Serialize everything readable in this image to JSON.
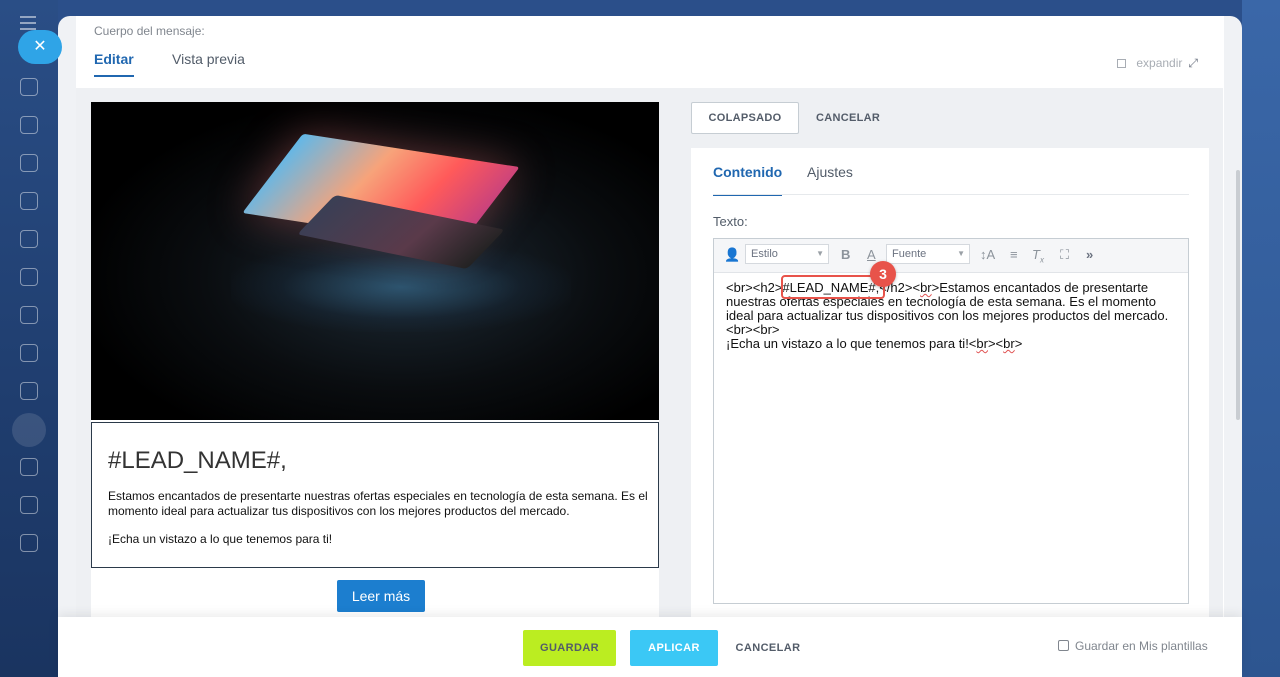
{
  "header": {
    "body_label": "Cuerpo del mensaje:",
    "tabs": [
      {
        "label": "Editar",
        "active": true
      },
      {
        "label": "Vista previa",
        "active": false
      }
    ],
    "expand_label": "expandir"
  },
  "preview": {
    "lead_name": "#LEAD_NAME#,",
    "paragraph1": "Estamos encantados de presentarte nuestras ofertas especiales en tecnología de esta semana. Es el momento ideal para actualizar tus dispositivos con los mejores productos del mercado.",
    "paragraph2": "¡Echa un vistazo a lo que tenemos para ti!",
    "button_label": "Leer más"
  },
  "side_panel": {
    "collapse_label": "COLAPSADO",
    "cancel_label": "CANCELAR",
    "tabs": [
      {
        "label": "Contenido",
        "active": true
      },
      {
        "label": "Ajustes",
        "active": false
      }
    ],
    "text_label": "Texto:",
    "toolbar": {
      "style_select": "Estilo",
      "font_select": "Fuente",
      "bold": "B",
      "color": "A",
      "more": "»"
    },
    "editor_text": {
      "part1": "<br><h2>",
      "lead": "#LEAD_NAME#,",
      "part2": "</h2><",
      "br1": "br",
      "part3": ">Estamos encantados de presentarte nuestras ofertas especiales en tecnología de esta semana. Es el momento ideal para actualizar tus dispositivos con los mejores productos del mercado. <br><br>",
      "line2_a": "¡Echa un vistazo a lo que tenemos para ti!<",
      "br2": "br",
      "line2_b": "><",
      "br3": "br",
      "line2_c": ">"
    },
    "step_badge": "3"
  },
  "footer": {
    "save_label": "GUARDAR",
    "apply_label": "APLICAR",
    "cancel_label": "CANCELAR",
    "template_checkbox_label": "Guardar en Mis plantillas",
    "template_checked": false
  },
  "colors": {
    "accent": "#2067b0",
    "save": "#bbed21",
    "apply": "#3bc8f5",
    "highlight": "#e8534a",
    "cta": "#1c7ecf"
  }
}
